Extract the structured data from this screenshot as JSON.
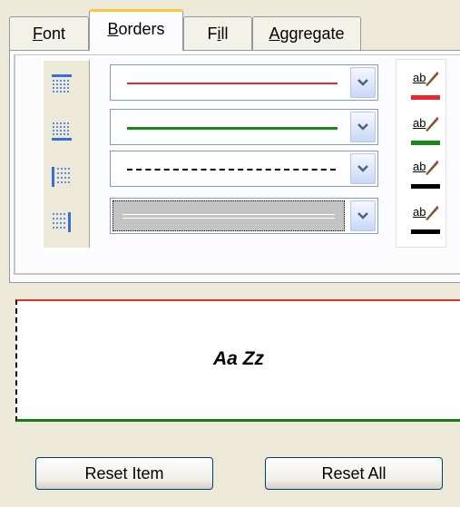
{
  "tabs": [
    {
      "label": "Font",
      "active": false
    },
    {
      "label": "Borders",
      "active": true
    },
    {
      "label": "Fill",
      "active": false
    },
    {
      "label": "Aggregate",
      "active": false
    }
  ],
  "border_rows": [
    {
      "position_icon": "top-border-icon",
      "line_style": "solid",
      "color": "#e8282b"
    },
    {
      "position_icon": "bottom-border-icon",
      "line_style": "solid-thick",
      "color": "#158a15"
    },
    {
      "position_icon": "left-border-icon",
      "line_style": "dashed",
      "color": "#000000"
    },
    {
      "position_icon": "right-border-icon",
      "line_style": "double-selected",
      "color": "#000000"
    }
  ],
  "color_icon": "abc-pencil-icon",
  "color_icon_text": "ab",
  "preview": {
    "text": "Aa Zz"
  },
  "buttons": {
    "reset_item": "Reset Item",
    "reset_all": "Reset All"
  }
}
